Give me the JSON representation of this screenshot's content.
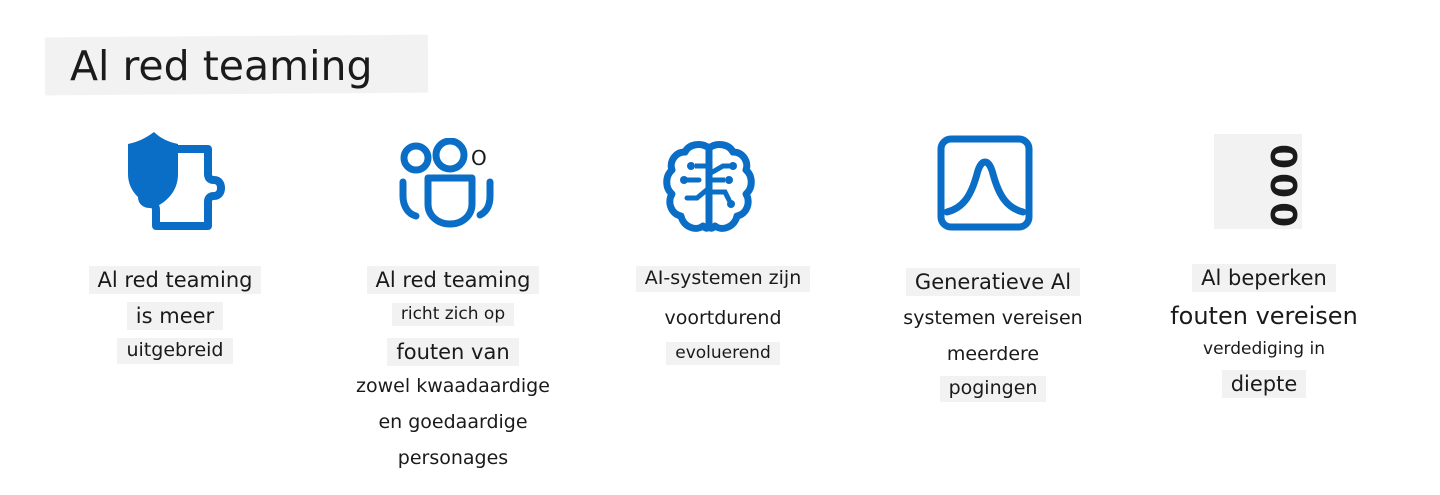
{
  "title": "Al red teaming",
  "accent_color": "#0a6ec7",
  "cards": [
    {
      "icon": "shield-puzzle-icon",
      "lines": [
        "Al red teaming",
        "is meer",
        "uitgebreid"
      ]
    },
    {
      "icon": "people-team-icon",
      "icon_text": "O",
      "lines": [
        "Al red teaming",
        "richt zich op",
        "fouten van",
        "zowel kwaadaardige",
        "en goedaardige",
        "personages"
      ]
    },
    {
      "icon": "brain-circuit-icon",
      "lines": [
        "AI-systemen zijn",
        "voortdurend",
        "evoluerend"
      ]
    },
    {
      "icon": "bell-curve-icon",
      "lines": [
        "Generatieve Al",
        "systemen vereisen",
        "meerdere",
        "pogingen"
      ]
    },
    {
      "icon": "ooo-icon",
      "icon_text": "000",
      "lines": [
        "Al beperken",
        "fouten vereisen",
        "verdediging in",
        "diepte"
      ]
    }
  ]
}
